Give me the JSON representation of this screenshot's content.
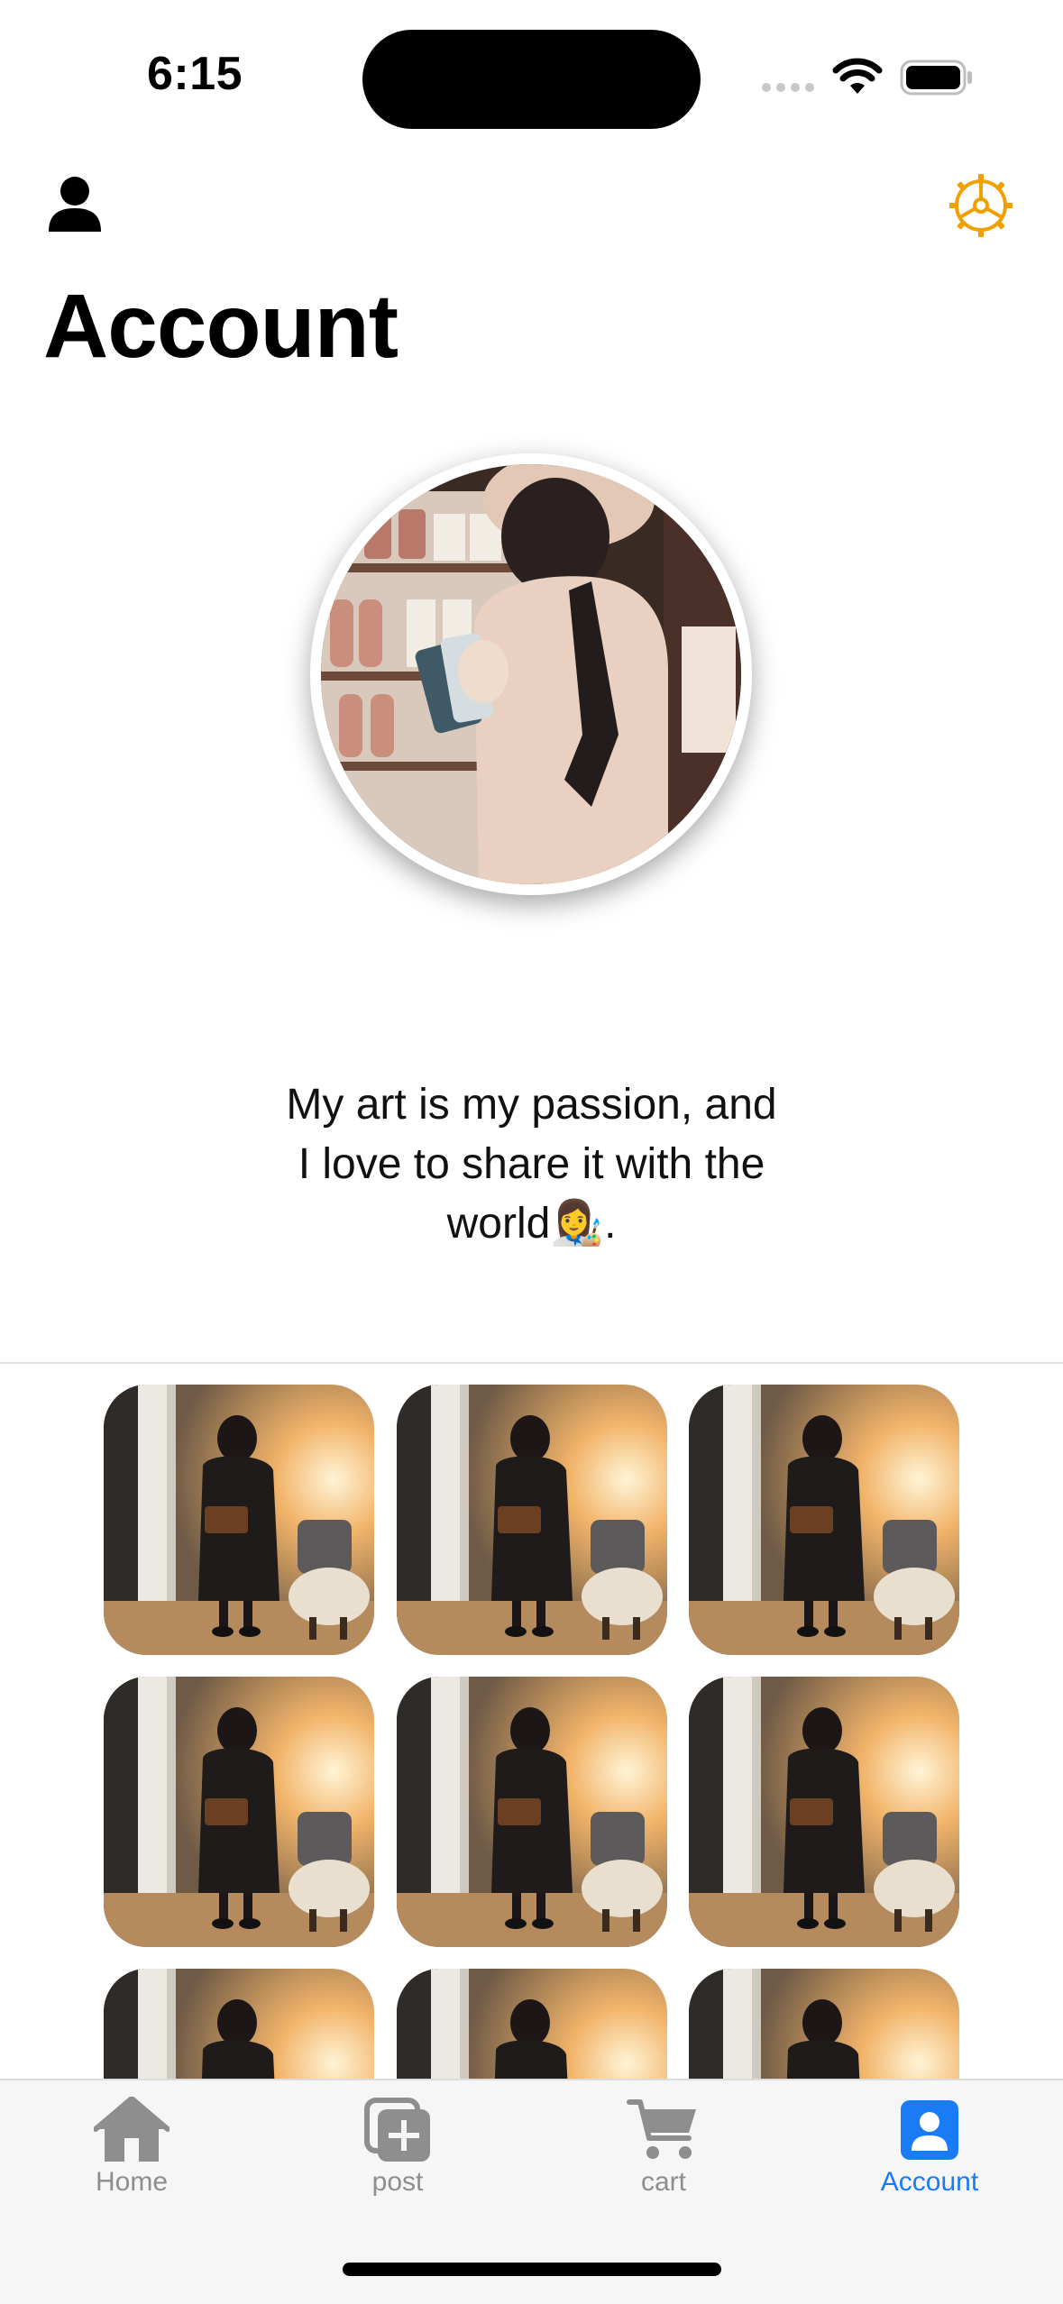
{
  "status_bar": {
    "time": "6:15"
  },
  "header": {
    "title": "Account"
  },
  "profile": {
    "bio_line1": "My art is my passion, and",
    "bio_line2": "I love to share it with the",
    "bio_line3": "world👩‍🎨."
  },
  "posts": [
    {
      "name": "post-1"
    },
    {
      "name": "post-2"
    },
    {
      "name": "post-3"
    },
    {
      "name": "post-4"
    },
    {
      "name": "post-5"
    },
    {
      "name": "post-6"
    },
    {
      "name": "post-7"
    },
    {
      "name": "post-8"
    },
    {
      "name": "post-9"
    }
  ],
  "tabs": [
    {
      "label": "Home",
      "icon": "house-icon"
    },
    {
      "label": "post",
      "icon": "plus-square-icon"
    },
    {
      "label": "cart",
      "icon": "cart-icon"
    },
    {
      "label": "Account",
      "icon": "person-square-icon",
      "active": true
    }
  ],
  "colors": {
    "accent": "#1a7cf5",
    "settings": "#f0a000",
    "inactive": "#8e8e8e"
  }
}
